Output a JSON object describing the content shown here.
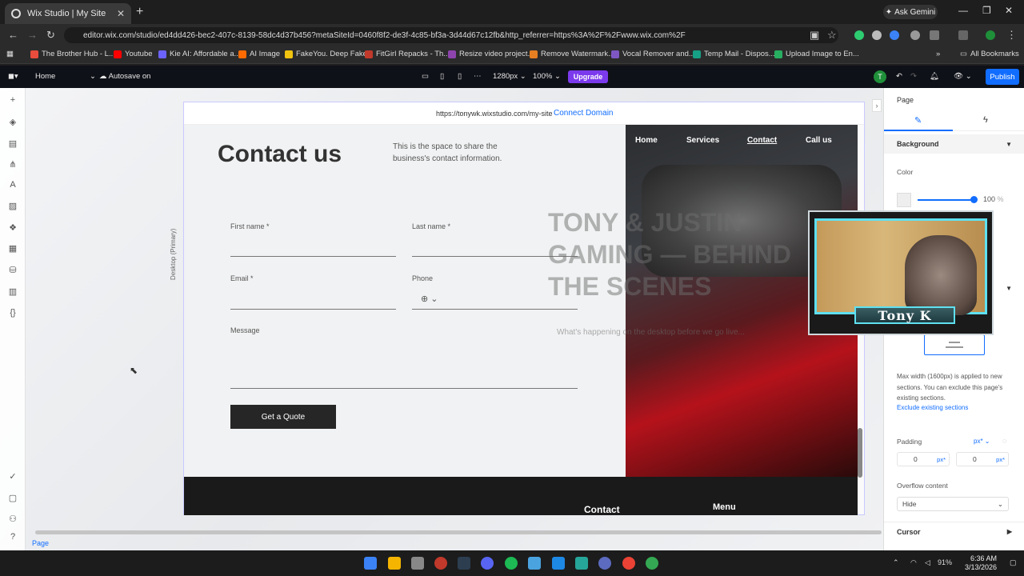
{
  "browser": {
    "tab_title": "Wix Studio | My Site",
    "ask_gemini": "Ask Gemini",
    "url": "editor.wix.com/studio/ed4dd426-bec2-407c-8139-58dc4d37b456?metaSiteId=0460f8f2-de3f-4c85-bf3a-3d44d67c12fb&http_referrer=https%3A%2F%2Fwww.wix.com%2F",
    "all_bookmarks": "All Bookmarks",
    "bookmarks": [
      {
        "label": "The Brother Hub - L...",
        "color": "#e74c3c"
      },
      {
        "label": "Youtube",
        "color": "#ff0000"
      },
      {
        "label": "Kie AI: Affordable a...",
        "color": "#6c63ff"
      },
      {
        "label": "AI Image",
        "color": "#ff6b00"
      },
      {
        "label": "FakeYou. Deep Fake...",
        "color": "#f1c40f"
      },
      {
        "label": "FitGirl Repacks - Th...",
        "color": "#c0392b"
      },
      {
        "label": "Resize video project...",
        "color": "#8e44ad"
      },
      {
        "label": "Remove Watermark...",
        "color": "#e67e22"
      },
      {
        "label": "Vocal Remover and...",
        "color": "#7e57c2"
      },
      {
        "label": "Temp Mail - Dispos...",
        "color": "#16a085"
      },
      {
        "label": "Upload Image to En...",
        "color": "#27ae60"
      }
    ]
  },
  "wix_toolbar": {
    "page": "Home",
    "autosave": "Autosave on",
    "breakpoint": "1280px",
    "zoom": "100%",
    "upgrade": "Upgrade",
    "user_initial": "T",
    "publish": "Publish"
  },
  "canvas": {
    "site_url": "https://tonywk.wixstudio.com/my-site",
    "connect_domain": "Connect Domain",
    "breakpoint_label": "Desktop (Primary)",
    "title": "Contact us",
    "description": "This is the space to share the business's contact information.",
    "fields": {
      "first_name": "First name *",
      "last_name": "Last name *",
      "email": "Email *",
      "phone": "Phone",
      "message": "Message"
    },
    "submit": "Get a Quote",
    "nav": [
      "Home",
      "Services",
      "Contact",
      "Call us"
    ],
    "overlay_title": "TONY & JUSTIN GAMING — BEHIND THE SCENES",
    "overlay_sub": "What's happening on the desktop before we go live...",
    "footer": {
      "contact": "Contact",
      "menu": "Menu"
    }
  },
  "page_tag": "Page",
  "right_panel": {
    "title": "Page",
    "background": "Background",
    "color_label": "Color",
    "opacity": "100",
    "opacity_unit": "%",
    "max_width_note": "Max width (1600px) is applied to new sections. You can exclude this page's existing sections.",
    "exclude_link": "Exclude existing sections",
    "padding": "Padding",
    "padding_unit": "px*",
    "pad_top": "0",
    "pad_bottom": "0",
    "overflow_label": "Overflow content",
    "overflow_value": "Hide",
    "cursor": "Cursor"
  },
  "webcam": {
    "name": "Tony K"
  },
  "taskbar": {
    "time": "6:36 AM",
    "date": "3/13/2026",
    "battery": "91%"
  }
}
